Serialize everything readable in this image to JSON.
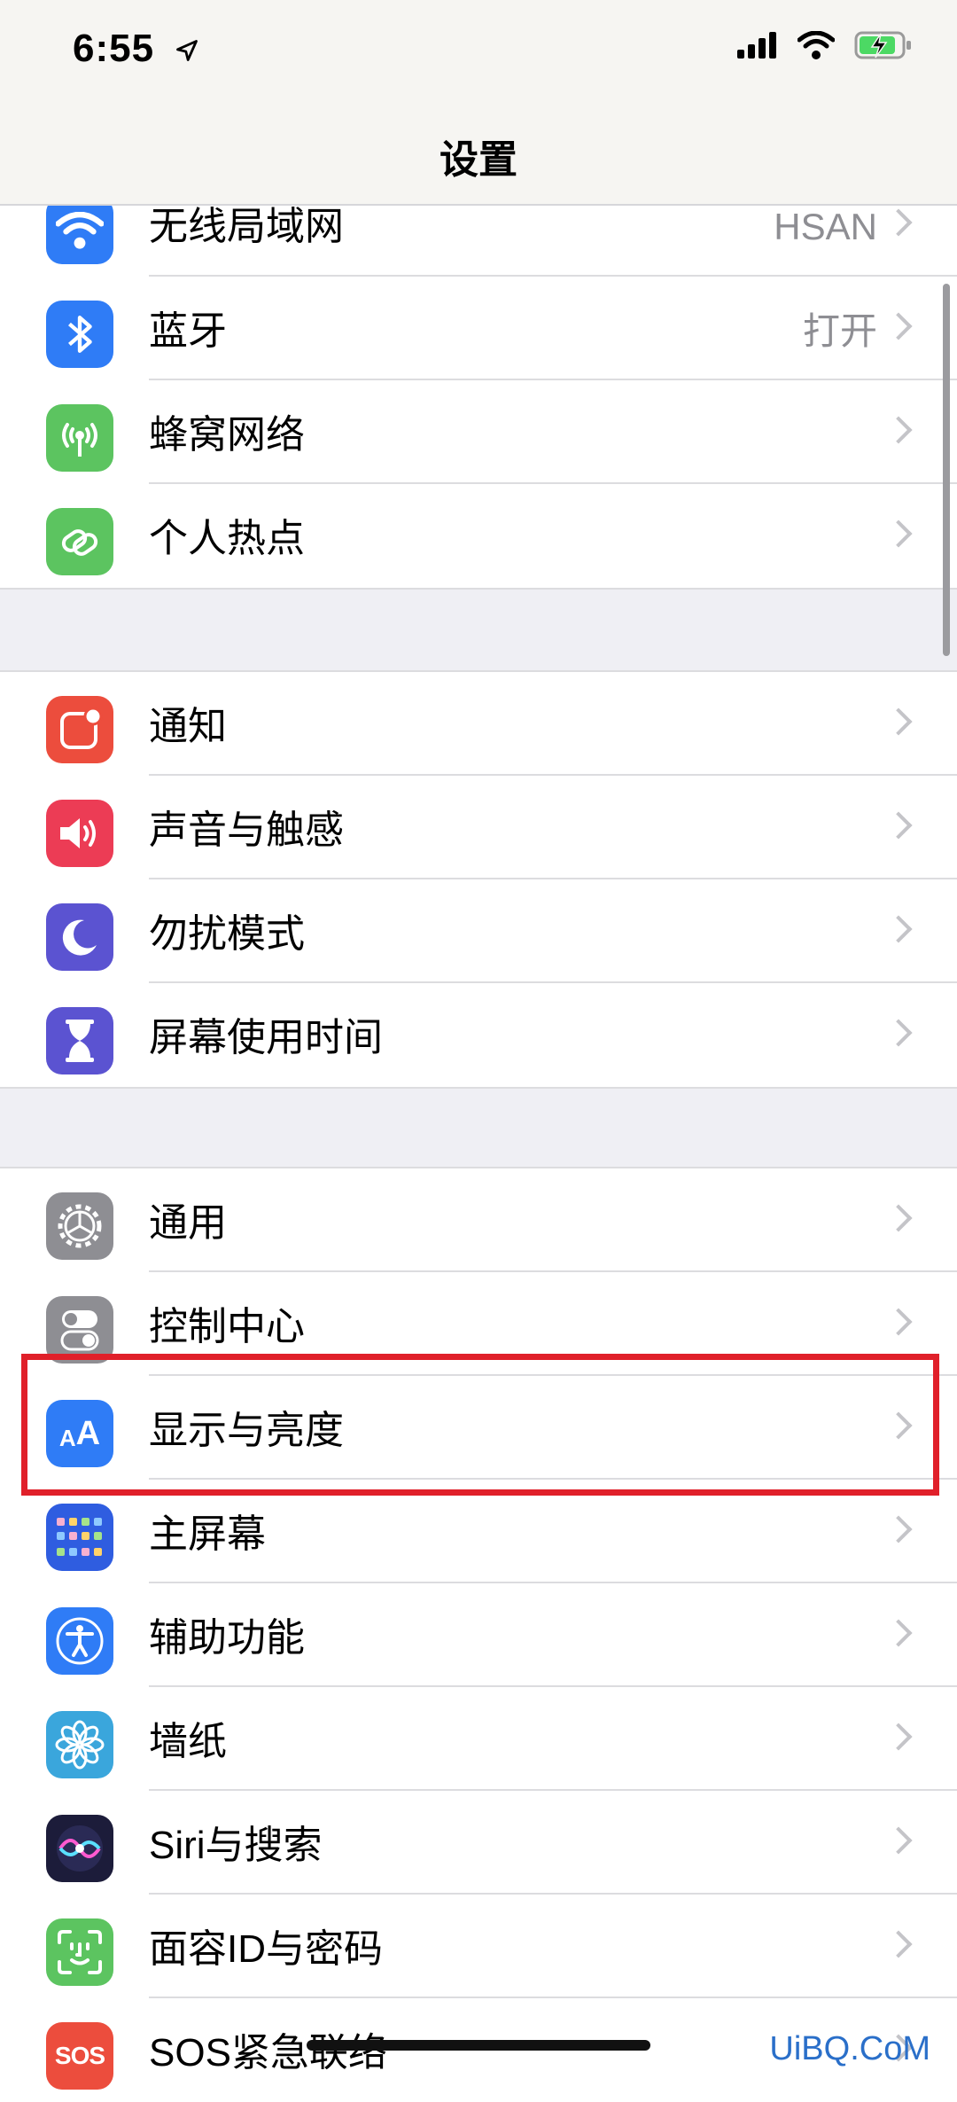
{
  "status_bar": {
    "time": "6:55"
  },
  "nav": {
    "title": "设置"
  },
  "groups": [
    {
      "items": [
        {
          "label": "无线局域网",
          "value": "HSAN",
          "icon": "wifi-icon",
          "color": "#2f7cf6"
        },
        {
          "label": "蓝牙",
          "value": "打开",
          "icon": "bluetooth-icon",
          "color": "#2f7cf6"
        },
        {
          "label": "蜂窝网络",
          "value": "",
          "icon": "antenna-icon",
          "color": "#5cc460"
        },
        {
          "label": "个人热点",
          "value": "",
          "icon": "link-icon",
          "color": "#5cc460"
        }
      ]
    },
    {
      "items": [
        {
          "label": "通知",
          "icon": "notifications-icon",
          "color": "#ec4d3d"
        },
        {
          "label": "声音与触感",
          "icon": "speaker-icon",
          "color": "#ec3c55"
        },
        {
          "label": "勿扰模式",
          "icon": "moon-icon",
          "color": "#5b53d1"
        },
        {
          "label": "屏幕使用时间",
          "icon": "hourglass-icon",
          "color": "#5b53d1"
        }
      ]
    },
    {
      "items": [
        {
          "label": "通用",
          "icon": "gear-icon",
          "color": "#8e8e93"
        },
        {
          "label": "控制中心",
          "icon": "toggles-icon",
          "color": "#8e8e93"
        },
        {
          "label": "显示与亮度",
          "icon": "text-size-icon",
          "color": "#2f7cf6"
        },
        {
          "label": "主屏幕",
          "icon": "home-screen-icon",
          "color": "#2f5de0"
        },
        {
          "label": "辅助功能",
          "icon": "accessibility-icon",
          "color": "#2f7cf6"
        },
        {
          "label": "墙纸",
          "icon": "flower-icon",
          "color": "#3aa6dc"
        },
        {
          "label": "Siri与搜索",
          "icon": "siri-icon",
          "color": "#1c1c3a"
        },
        {
          "label": "面容ID与密码",
          "icon": "face-id-icon",
          "color": "#5cc460"
        },
        {
          "label": "SOS紧急联络",
          "icon": "sos-icon",
          "color": "#ec4d3d"
        }
      ]
    }
  ],
  "highlight": {
    "item": "显示与亮度",
    "color": "#e0202a"
  },
  "watermark": "UiBQ.CoM"
}
